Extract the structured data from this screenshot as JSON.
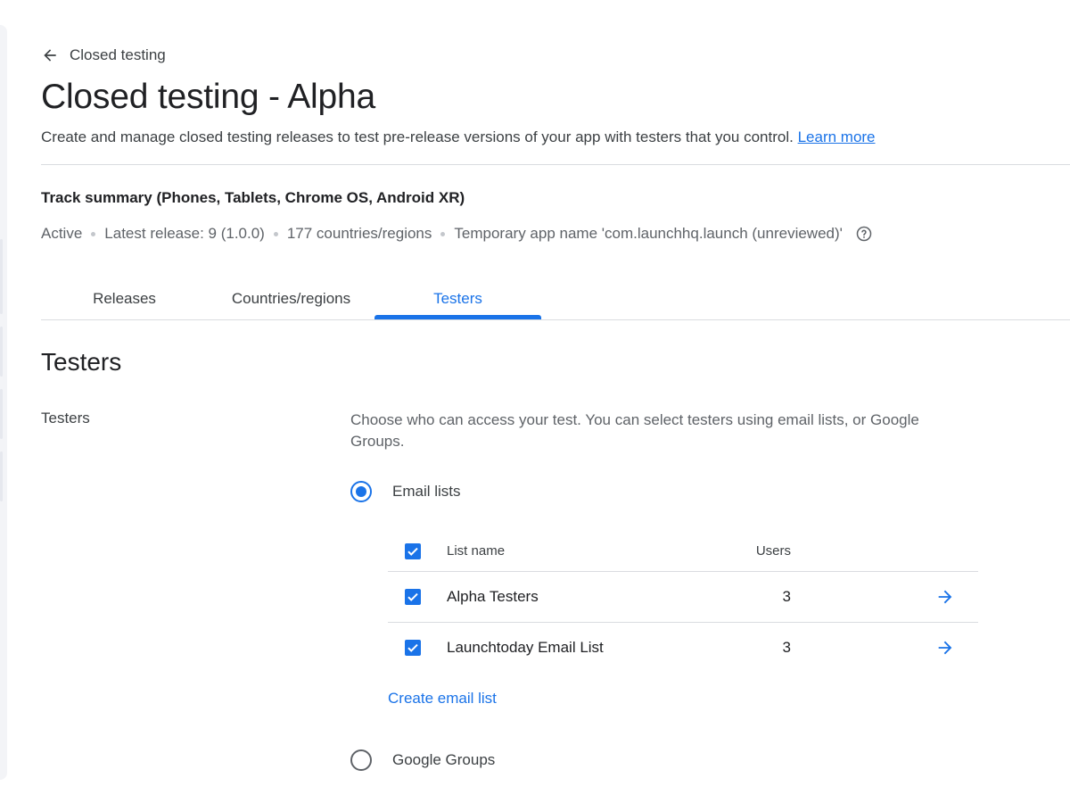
{
  "back_link": {
    "label": "Closed testing",
    "icon": "arrow-left-icon"
  },
  "page": {
    "title": "Closed testing - Alpha",
    "description": "Create and manage closed testing releases to test pre-release versions of your app with testers that you control.",
    "learn_more": "Learn more"
  },
  "track_summary": {
    "title": "Track summary (Phones, Tablets, Chrome OS, Android XR)",
    "status": "Active",
    "latest_release": "Latest release: 9 (1.0.0)",
    "countries": "177 countries/regions",
    "temp_app_name": "Temporary app name 'com.launchhq.launch (unreviewed)'",
    "help_icon": "help-circle-icon"
  },
  "tabs": [
    {
      "label": "Releases",
      "active": false
    },
    {
      "label": "Countries/regions",
      "active": false
    },
    {
      "label": "Testers",
      "active": true
    }
  ],
  "testers": {
    "section_title": "Testers",
    "row_label": "Testers",
    "description": "Choose who can access your test. You can select testers using email lists, or Google Groups.",
    "options": [
      {
        "label": "Email lists",
        "selected": true
      },
      {
        "label": "Google Groups",
        "selected": false
      }
    ],
    "email_table": {
      "columns": [
        "List name",
        "Users"
      ],
      "rows": [
        {
          "name": "Alpha Testers",
          "users": "3",
          "checked": true
        },
        {
          "name": "Launchtoday Email List",
          "users": "3",
          "checked": true
        }
      ]
    },
    "create_link": "Create email list"
  },
  "colors": {
    "accent": "#1a73e8",
    "text": "#202124",
    "secondary_text": "#5f6368",
    "divider": "#dadce0"
  }
}
